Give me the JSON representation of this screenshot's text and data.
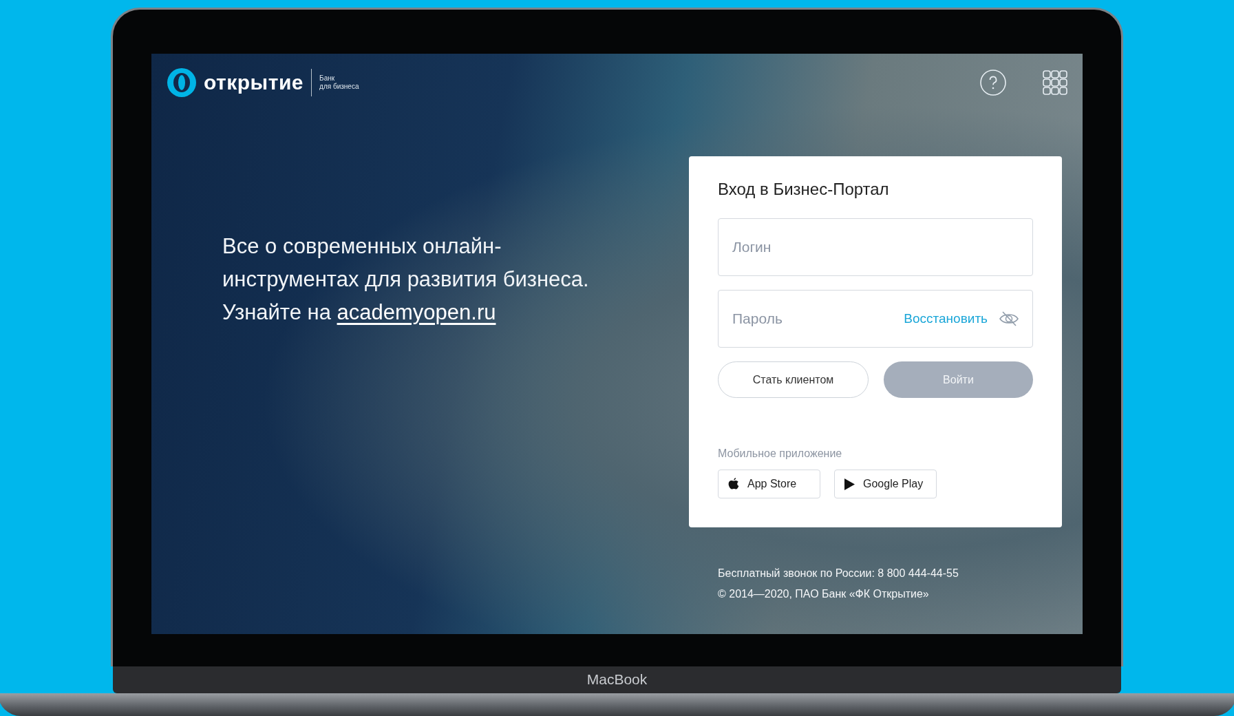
{
  "header": {
    "logo": {
      "name": "открытие",
      "tagline": [
        "Банк",
        "для бизнеса"
      ]
    }
  },
  "promo": {
    "text": "Все о современных онлайн-инструментах для развития бизнеса. Узнайте на ",
    "link": "academyopen.ru"
  },
  "login_card": {
    "title": "Вход в Бизнес-Портал",
    "fields": [
      {
        "kind": "text",
        "placeholder": "Логин"
      },
      {
        "kind": "password",
        "placeholder": "Пароль",
        "action": "Восстановить"
      }
    ],
    "buttons": [
      {
        "kind": "outline",
        "label": "Стать клиентом",
        "disabled": false
      },
      {
        "kind": "primary",
        "label": "Войти",
        "disabled": true
      }
    ],
    "mobile_app": {
      "label": "Мобильное приложение",
      "stores": [
        {
          "kind": "apple",
          "label": "App Store"
        },
        {
          "kind": "play",
          "label": "Google Play"
        }
      ]
    }
  },
  "footer": [
    "Бесплатный звонок по России: 8 800 444-44-55",
    "© 2014—2020, ПАО Банк «ФК Открытие»"
  ],
  "device": {
    "label": "MacBook"
  }
}
